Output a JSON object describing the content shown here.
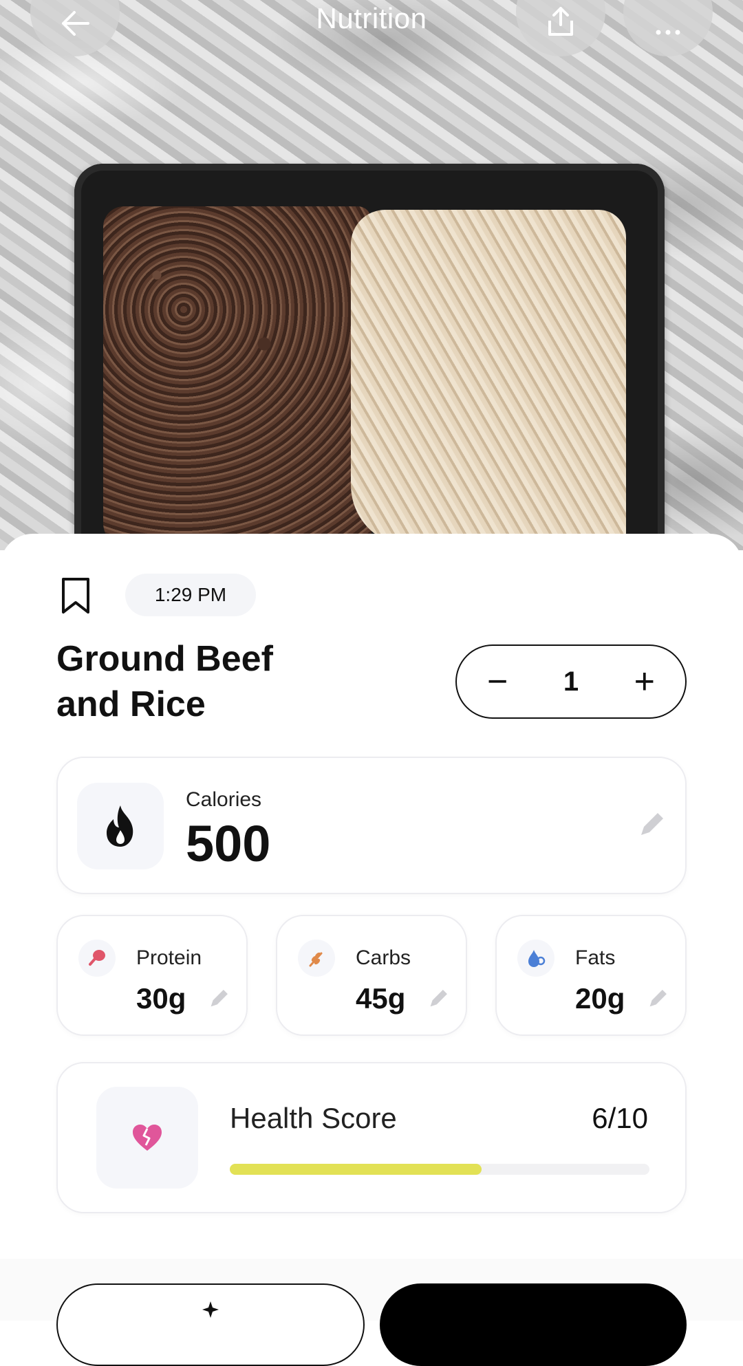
{
  "header": {
    "title": "Nutrition"
  },
  "meal": {
    "time": "1:29 PM",
    "title_line1": "Ground Beef",
    "title_line2": "and Rice",
    "quantity": "1",
    "decrement_label": "−",
    "increment_label": "+"
  },
  "calories": {
    "label": "Calories",
    "value": "500"
  },
  "macros": [
    {
      "label": "Protein",
      "value": "30g",
      "icon": "drumstick-icon",
      "color": "#e0566a"
    },
    {
      "label": "Carbs",
      "value": "45g",
      "icon": "wheat-icon",
      "color": "#e08a4a"
    },
    {
      "label": "Fats",
      "value": "20g",
      "icon": "droplet-icon",
      "color": "#4b7fd6"
    }
  ],
  "health_score": {
    "label": "Health Score",
    "value": "6/10",
    "score": 6,
    "max": 10,
    "bar_color": "#e2e155"
  },
  "colors": {
    "flame": "#111111",
    "heart": "#e0569a"
  }
}
